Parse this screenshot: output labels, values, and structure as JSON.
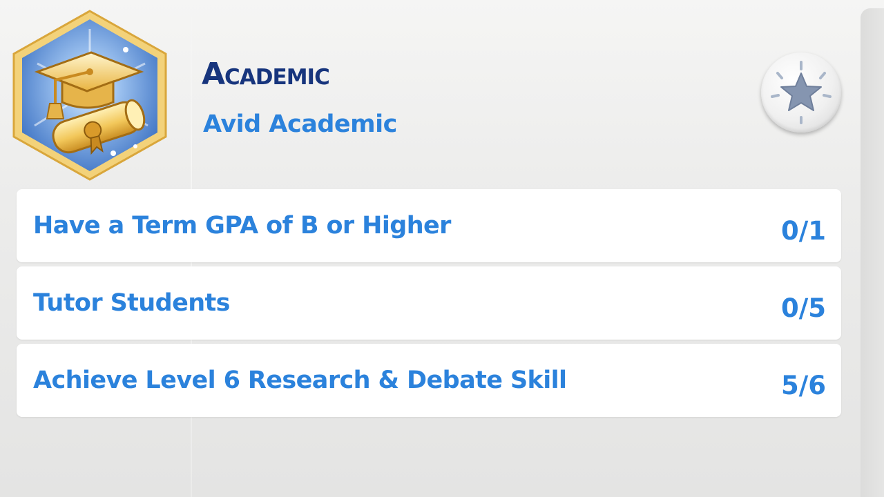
{
  "aspiration": {
    "category": "Academic",
    "name": "Avid Academic",
    "icon": "graduation-cap-diploma-icon"
  },
  "milestone_button": {
    "icon": "star-icon"
  },
  "goals": [
    {
      "label": "Have a Term GPA of B or Higher",
      "progress": "0/1"
    },
    {
      "label": "Tutor Students",
      "progress": "0/5"
    },
    {
      "label": "Achieve Level 6 Research & Debate Skill",
      "progress": "5/6"
    }
  ],
  "colors": {
    "title": "#17357d",
    "accent": "#2b82dc",
    "badge_border": "#e2b54a",
    "badge_fill": "#5a8fd6"
  }
}
